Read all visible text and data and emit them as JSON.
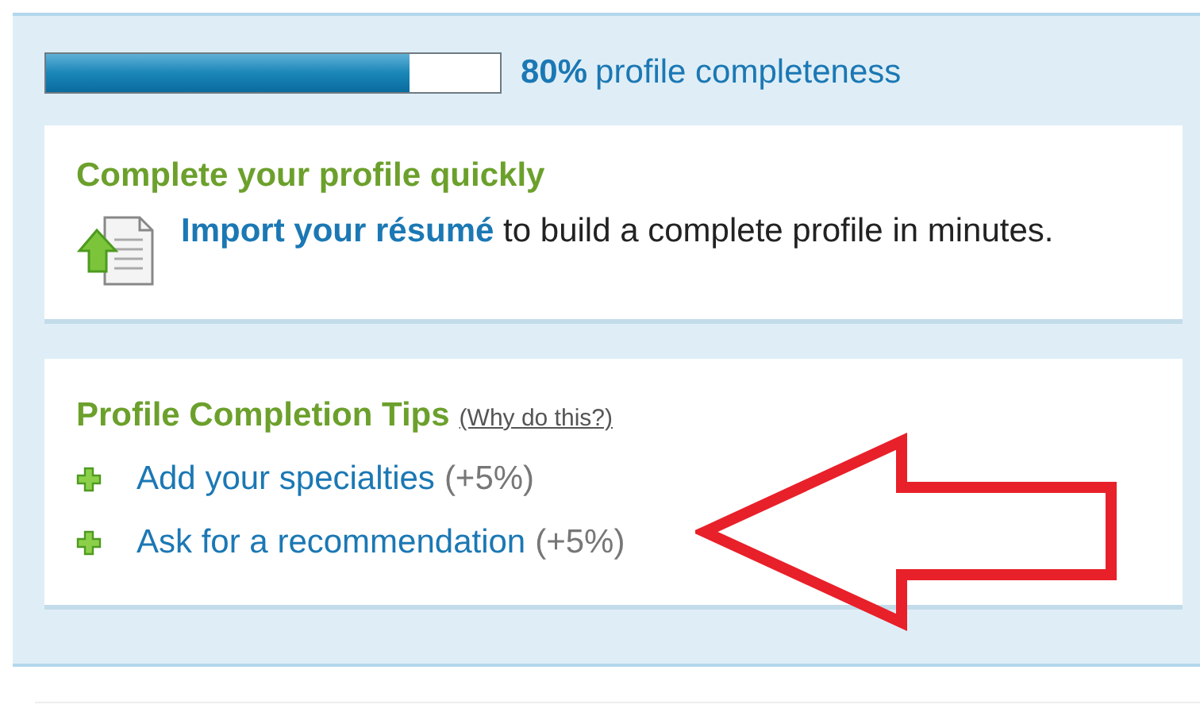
{
  "progress": {
    "level": 0.8,
    "percent": "80%",
    "label": "profile completeness"
  },
  "import_card": {
    "title": "Complete your profile quickly",
    "link": "Import your résumé",
    "text": " to build a complete profile in minutes."
  },
  "tips_card": {
    "title": "Profile Completion Tips",
    "help_link": "(Why do this?)",
    "tips": [
      {
        "label": "Add your specialties",
        "bonus": "(+5%)"
      },
      {
        "label": "Ask for a recommendation",
        "bonus": "(+5%)"
      }
    ]
  }
}
